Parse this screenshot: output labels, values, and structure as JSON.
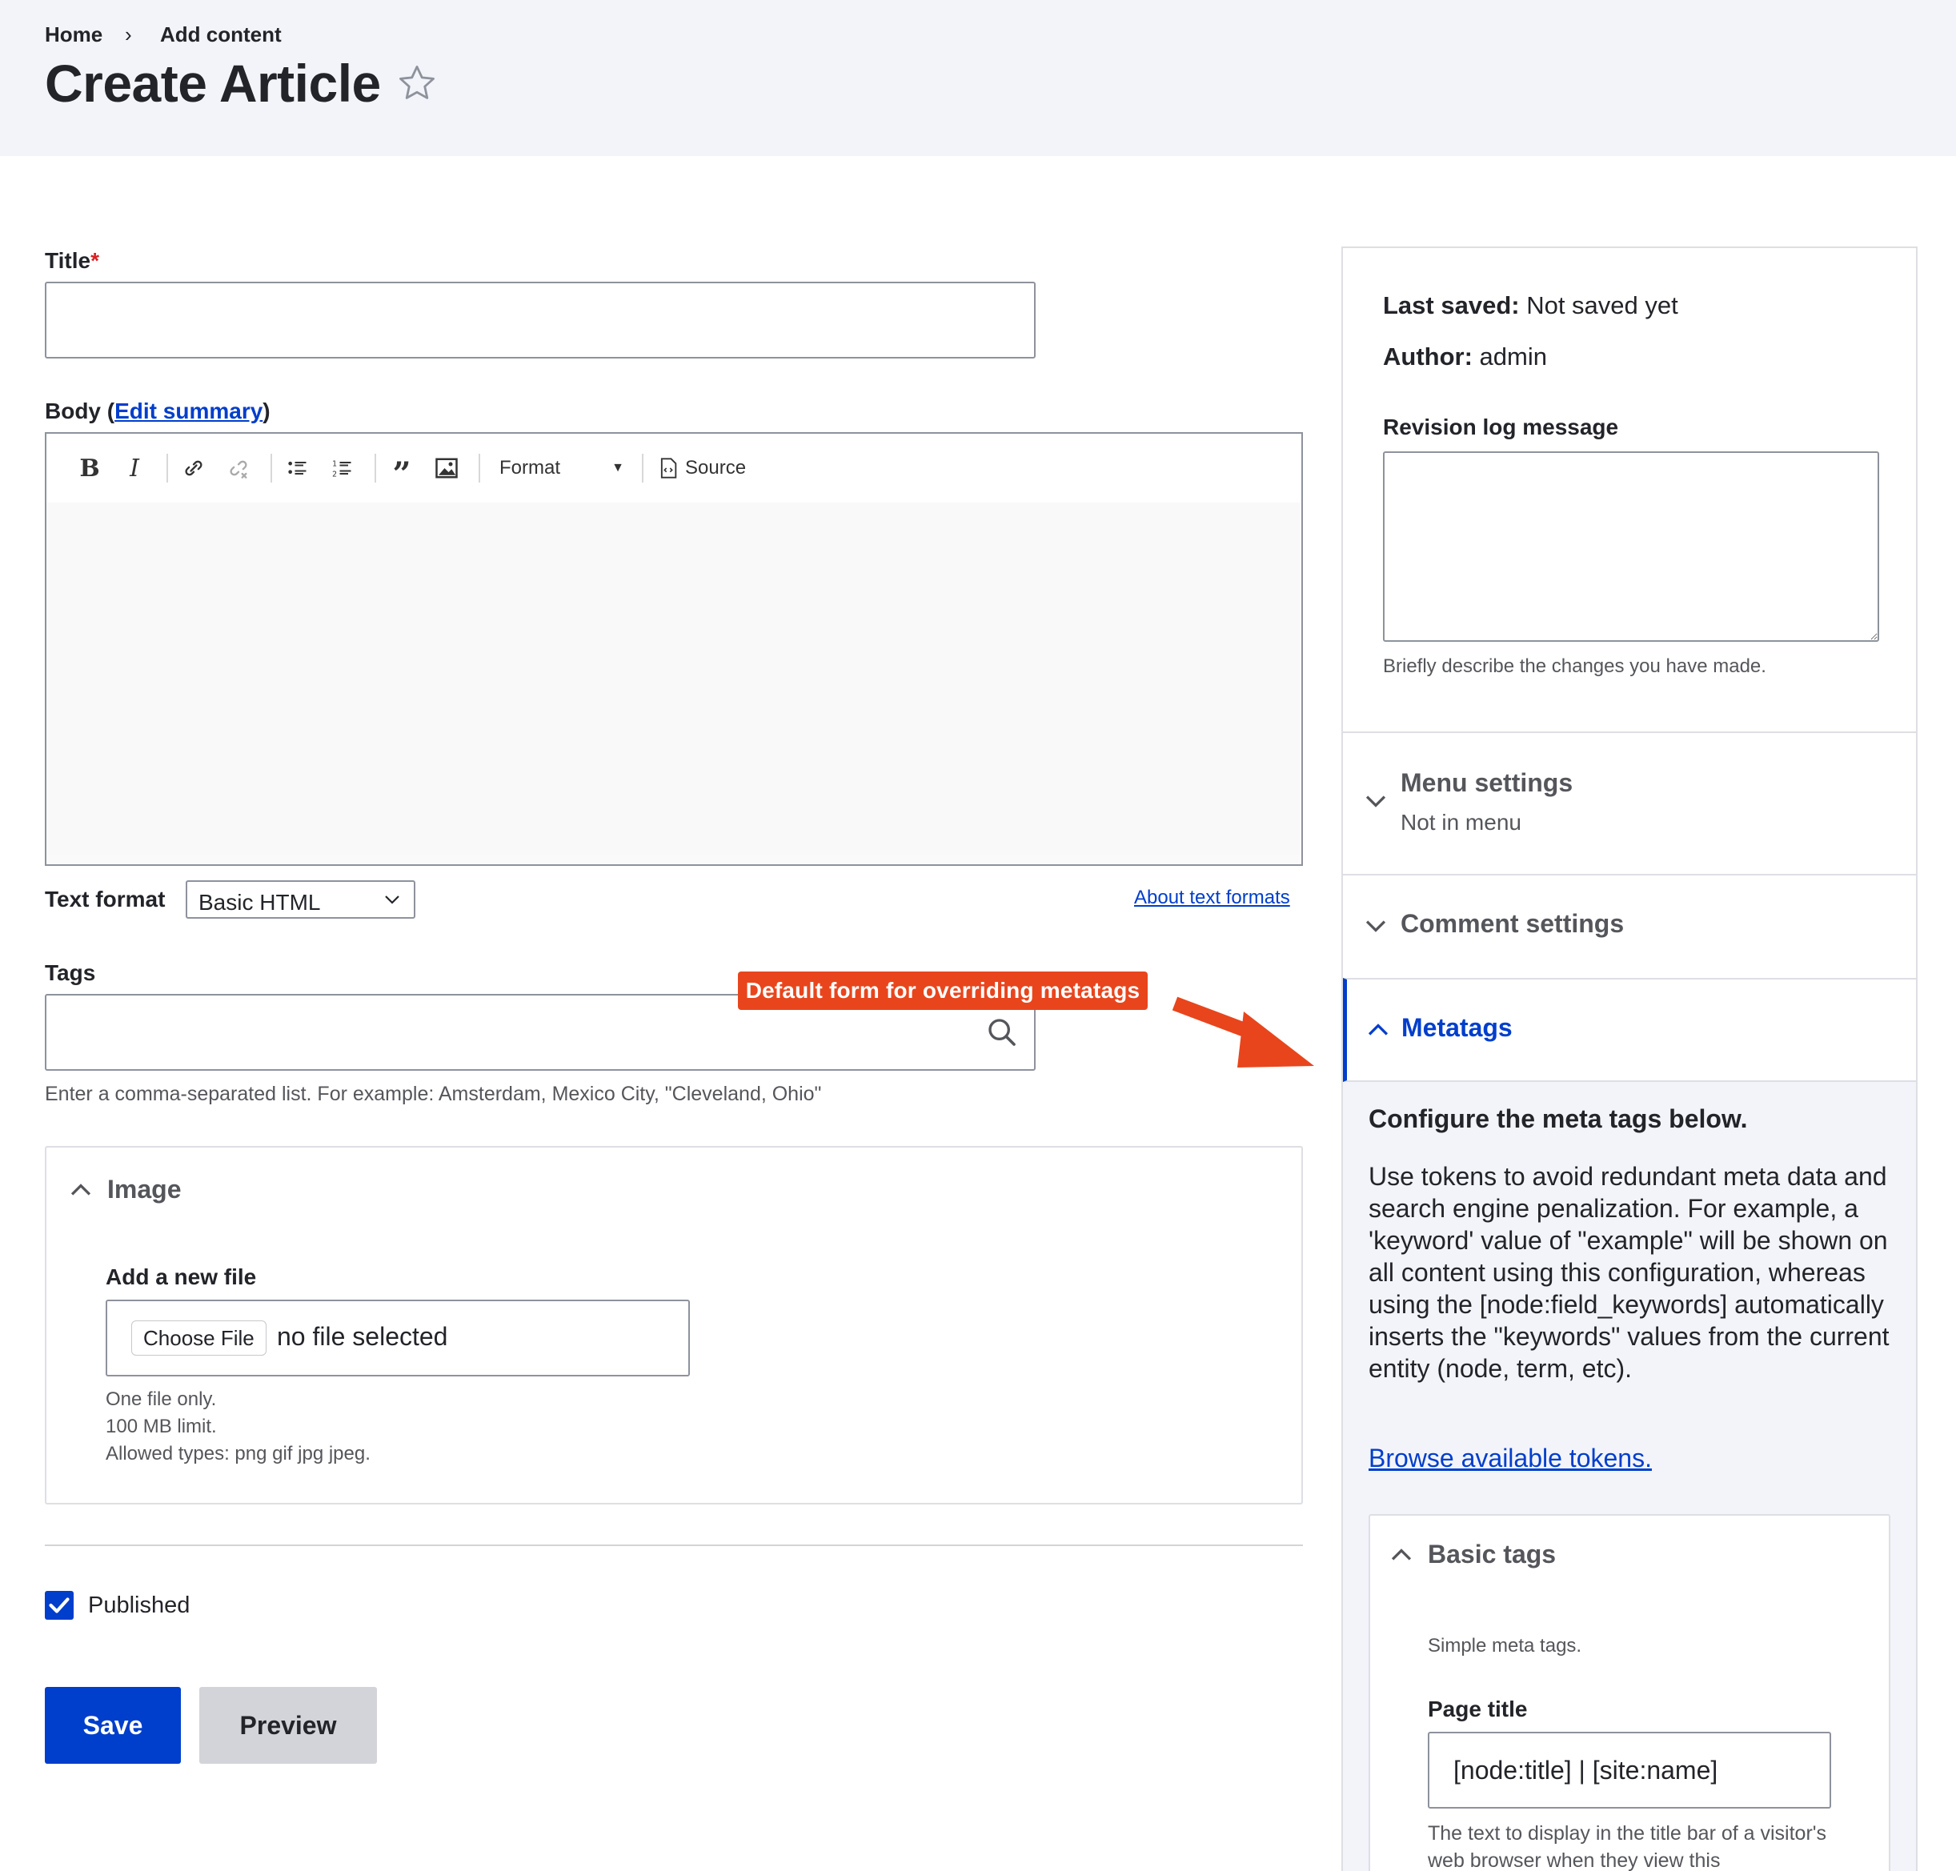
{
  "breadcrumb": {
    "home": "Home",
    "separator": "›",
    "current": "Add content"
  },
  "page_title": "Create Article",
  "title_field": {
    "label": "Title",
    "required_mark": "*",
    "value": ""
  },
  "body_field": {
    "label": "Body",
    "edit_summary": "Edit summary",
    "paren_open": "(",
    "paren_close": ")"
  },
  "toolbar": {
    "format_label": "Format",
    "source_label": "Source"
  },
  "text_format": {
    "label": "Text format",
    "selected": "Basic HTML",
    "about_link": "About text formats"
  },
  "tags": {
    "label": "Tags",
    "value": "",
    "help": "Enter a comma-separated list. For example: Amsterdam, Mexico City, \"Cleveland, Ohio\""
  },
  "annotation": {
    "text": "Default form for overriding metatags",
    "color": "#e8451d"
  },
  "image": {
    "title": "Image",
    "add_label": "Add a new file",
    "choose_button": "Choose File",
    "no_file": "no file selected",
    "help": [
      "One file only.",
      "100 MB limit.",
      "Allowed types: png gif jpg jpeg."
    ]
  },
  "published": {
    "label": "Published",
    "checked": true
  },
  "actions": {
    "save": "Save",
    "preview": "Preview"
  },
  "sidebar": {
    "last_saved_label": "Last saved:",
    "last_saved_value": "Not saved yet",
    "author_label": "Author:",
    "author_value": "admin",
    "revision_label": "Revision log message",
    "revision_help": "Briefly describe the changes you have made.",
    "menu_settings": {
      "title": "Menu settings",
      "summary": "Not in menu"
    },
    "comment_settings": {
      "title": "Comment settings"
    },
    "metatags": {
      "title": "Metatags",
      "heading": "Configure the meta tags below.",
      "description": "Use tokens to avoid redundant meta data and search engine penalization. For example, a 'keyword' value of \"example\" will be shown on all content using this configuration, whereas using the [node:field_keywords] automatically inserts the \"keywords\" values from the current entity (node, term, etc).",
      "browse_link": "Browse available tokens.",
      "basic_tags": {
        "title": "Basic tags",
        "description": "Simple meta tags.",
        "page_title_label": "Page title",
        "page_title_value": "[node:title] | [site:name]",
        "page_title_help": "The text to display in the title bar of a visitor's web browser when they view this"
      }
    }
  },
  "colors": {
    "primary": "#003ecc",
    "header_bg": "#f3f4f9",
    "required": "#d72222"
  }
}
